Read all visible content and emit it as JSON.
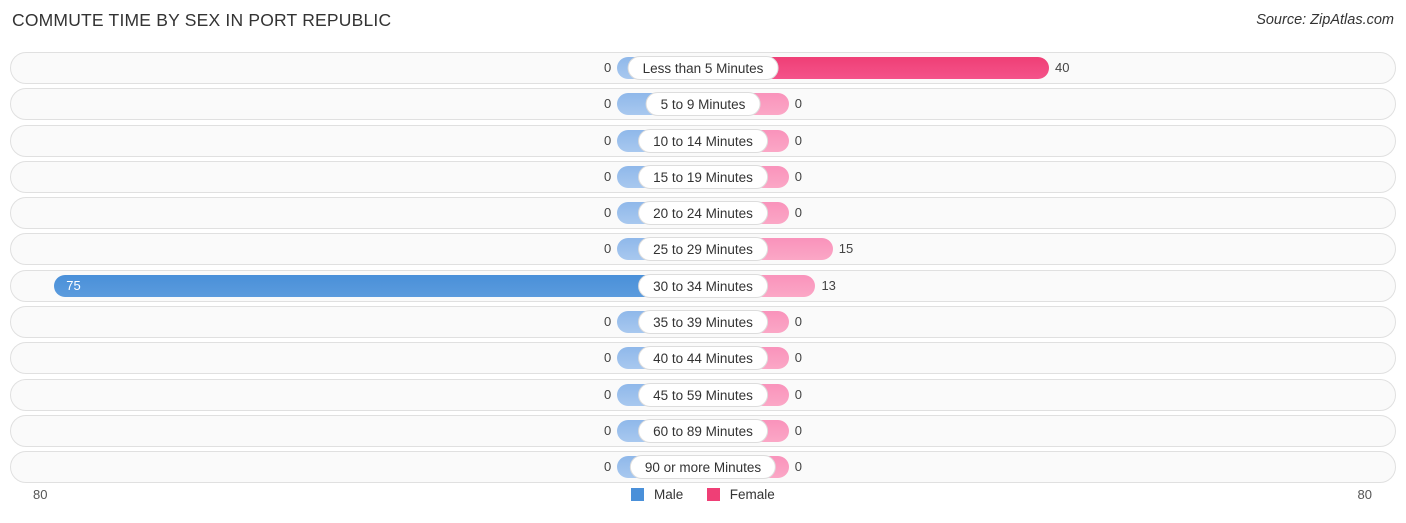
{
  "header": {
    "title": "COMMUTE TIME BY SEX IN PORT REPUBLIC",
    "source": "Source: ZipAtlas.com"
  },
  "axis": {
    "left_label": "80",
    "right_label": "80"
  },
  "legend": {
    "male": "Male",
    "female": "Female"
  },
  "chart_data": {
    "type": "bar",
    "orientation": "horizontal-diverging",
    "title": "COMMUTE TIME BY SEX IN PORT REPUBLIC",
    "xlabel": "",
    "ylabel": "",
    "xlim": [
      80,
      80
    ],
    "grid": false,
    "legend_position": "bottom-center",
    "colors": {
      "male": "#4a90d9",
      "female": "#ef3f76"
    },
    "categories": [
      "Less than 5 Minutes",
      "5 to 9 Minutes",
      "10 to 14 Minutes",
      "15 to 19 Minutes",
      "20 to 24 Minutes",
      "25 to 29 Minutes",
      "30 to 34 Minutes",
      "35 to 39 Minutes",
      "40 to 44 Minutes",
      "45 to 59 Minutes",
      "60 to 89 Minutes",
      "90 or more Minutes"
    ],
    "series": [
      {
        "name": "Male",
        "values": [
          0,
          0,
          0,
          0,
          0,
          0,
          75,
          0,
          0,
          0,
          0,
          0
        ]
      },
      {
        "name": "Female",
        "values": [
          40,
          0,
          0,
          0,
          0,
          15,
          13,
          0,
          0,
          0,
          0,
          0
        ]
      }
    ]
  },
  "rows": [
    {
      "label": "Less than 5 Minutes",
      "male": "0",
      "female": "40"
    },
    {
      "label": "5 to 9 Minutes",
      "male": "0",
      "female": "0"
    },
    {
      "label": "10 to 14 Minutes",
      "male": "0",
      "female": "0"
    },
    {
      "label": "15 to 19 Minutes",
      "male": "0",
      "female": "0"
    },
    {
      "label": "20 to 24 Minutes",
      "male": "0",
      "female": "0"
    },
    {
      "label": "25 to 29 Minutes",
      "male": "0",
      "female": "15"
    },
    {
      "label": "30 to 34 Minutes",
      "male": "75",
      "female": "13"
    },
    {
      "label": "35 to 39 Minutes",
      "male": "0",
      "female": "0"
    },
    {
      "label": "40 to 44 Minutes",
      "male": "0",
      "female": "0"
    },
    {
      "label": "45 to 59 Minutes",
      "male": "0",
      "female": "0"
    },
    {
      "label": "60 to 89 Minutes",
      "male": "0",
      "female": "0"
    },
    {
      "label": "90 or more Minutes",
      "male": "0",
      "female": "0"
    }
  ]
}
